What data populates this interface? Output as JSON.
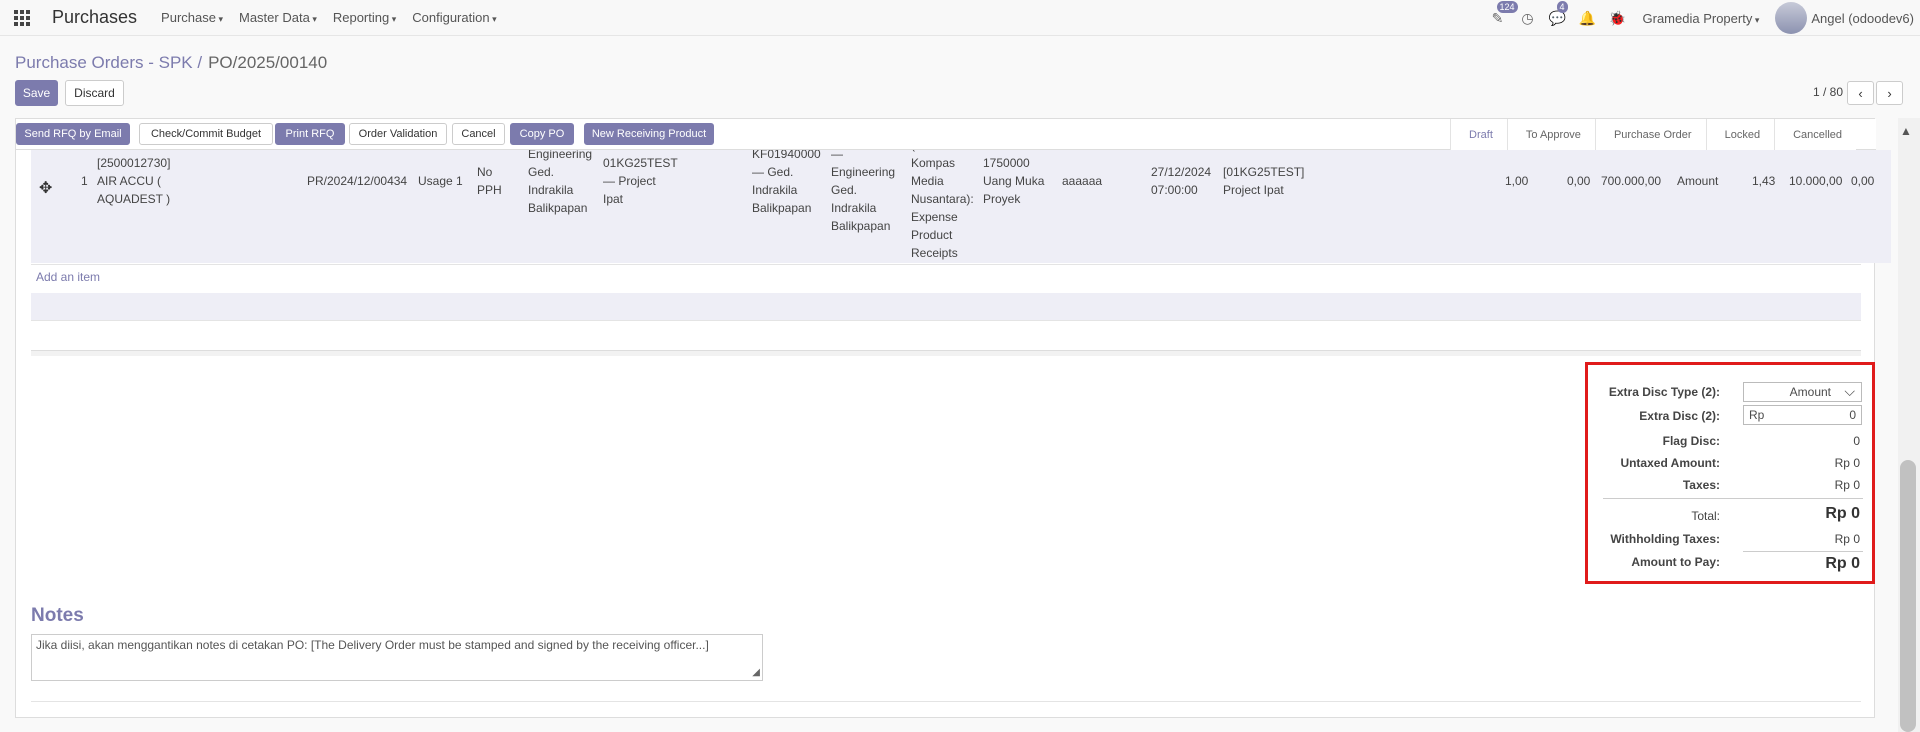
{
  "navbar": {
    "brand": "Purchases",
    "menu": [
      "Purchase",
      "Master Data",
      "Reporting",
      "Configuration"
    ],
    "activity_badge": "124",
    "messages_badge": "4",
    "company": "Gramedia Property",
    "user": "Angel (odoodev6)"
  },
  "breadcrumb": {
    "parent": "Purchase Orders - SPK /",
    "current": "PO/2025/00140"
  },
  "form_buttons": {
    "save": "Save",
    "discard": "Discard"
  },
  "pager": {
    "value": "1 / 80",
    "prev": "‹",
    "next": "›"
  },
  "header_buttons": [
    "Send RFQ by Email",
    "Check/Commit Budget",
    "Print RFQ",
    "Order Validation",
    "Cancel",
    "Copy PO",
    "New Receiving Product"
  ],
  "statusbar": [
    "Draft",
    "To Approve",
    "Purchase Order",
    "Locked",
    "Cancelled"
  ],
  "order_line": {
    "seq": "1",
    "product": "[2500012730]\nAIR ACCU (\nAQUADEST )",
    "pr": "PR/2024/12/00434",
    "usage": "Usage 1",
    "pph": "No\nPPH",
    "location": "Engineering\nGed.\nIndrakila\nBalikpapan",
    "project": "01KG25TEST\n— Project\nIpat",
    "dest": "KF01940000\n— Ged.\nIndrakila\nBalikpapan",
    "dept": "—\nEngineering\nGed.\nIndrakila\nBalikpapan",
    "account": "(\nKompas\nMedia\nNusantara):\nExpense\nProduct\nReceipts",
    "budget": "1750000\nUang Muka\nProyek",
    "desc": "aaaaaa",
    "date": "27/12/2024\n07:00:00",
    "analytic": "[01KG25TEST]\nProject Ipat",
    "qty": "1,00",
    "received": "0,00",
    "price": "700.000,00",
    "disc_type": "Amount",
    "disc": "1,43",
    "disc_amount": "10.000,00",
    "last": "0,00"
  },
  "add_item": "Add an item",
  "totals": {
    "extra_disc_type_label": "Extra Disc Type (2):",
    "extra_disc_type_value": "Amount",
    "extra_disc_label": "Extra Disc (2):",
    "extra_disc_currency": "Rp",
    "extra_disc_value": "0",
    "flag_disc_label": "Flag Disc:",
    "flag_disc_value": "0",
    "untaxed_label": "Untaxed Amount:",
    "untaxed_value": "Rp 0",
    "taxes_label": "Taxes:",
    "taxes_value": "Rp 0",
    "total_label": "Total:",
    "total_value": "Rp 0",
    "withholding_label": "Withholding Taxes:",
    "withholding_value": "Rp 0",
    "amount_to_pay_label": "Amount to Pay:",
    "amount_to_pay_value": "Rp 0"
  },
  "notes": {
    "title": "Notes",
    "placeholder": "Jika diisi, akan menggantikan notes di cetakan PO: [The Delivery Order must be stamped and signed by the receiving officer...]"
  }
}
